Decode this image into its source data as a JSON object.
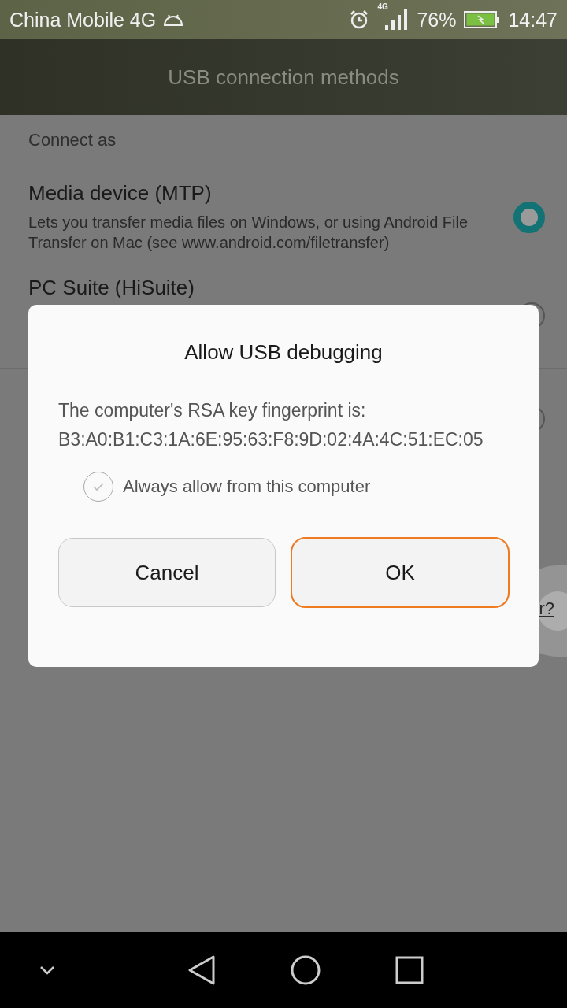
{
  "status_bar": {
    "carrier": "China Mobile 4G",
    "network": "4G",
    "battery": "76%",
    "time": "14:47"
  },
  "title": "USB connection methods",
  "list": {
    "header": "Connect as",
    "options": [
      {
        "title": "Media device (MTP)",
        "description": "Lets you transfer media files on Windows, or using Android File Transfer on Mac (see www.android.com/filetransfer)",
        "selected": true
      },
      {
        "title": "PC Suite (HiSuite)",
        "selected": false
      },
      {
        "selected": false
      }
    ],
    "link": "r?"
  },
  "dialog": {
    "title": "Allow USB debugging",
    "message": "The computer's RSA key fingerprint is:",
    "fingerprint": "B3:A0:B1:C3:1A:6E:95:63:F8:9D:02:4A:4C:51:EC:05",
    "checkbox": {
      "label": "Always allow from this computer",
      "checked": false
    },
    "buttons": [
      {
        "label": "Cancel",
        "highlighted": false
      },
      {
        "label": "OK",
        "highlighted": true
      }
    ]
  }
}
